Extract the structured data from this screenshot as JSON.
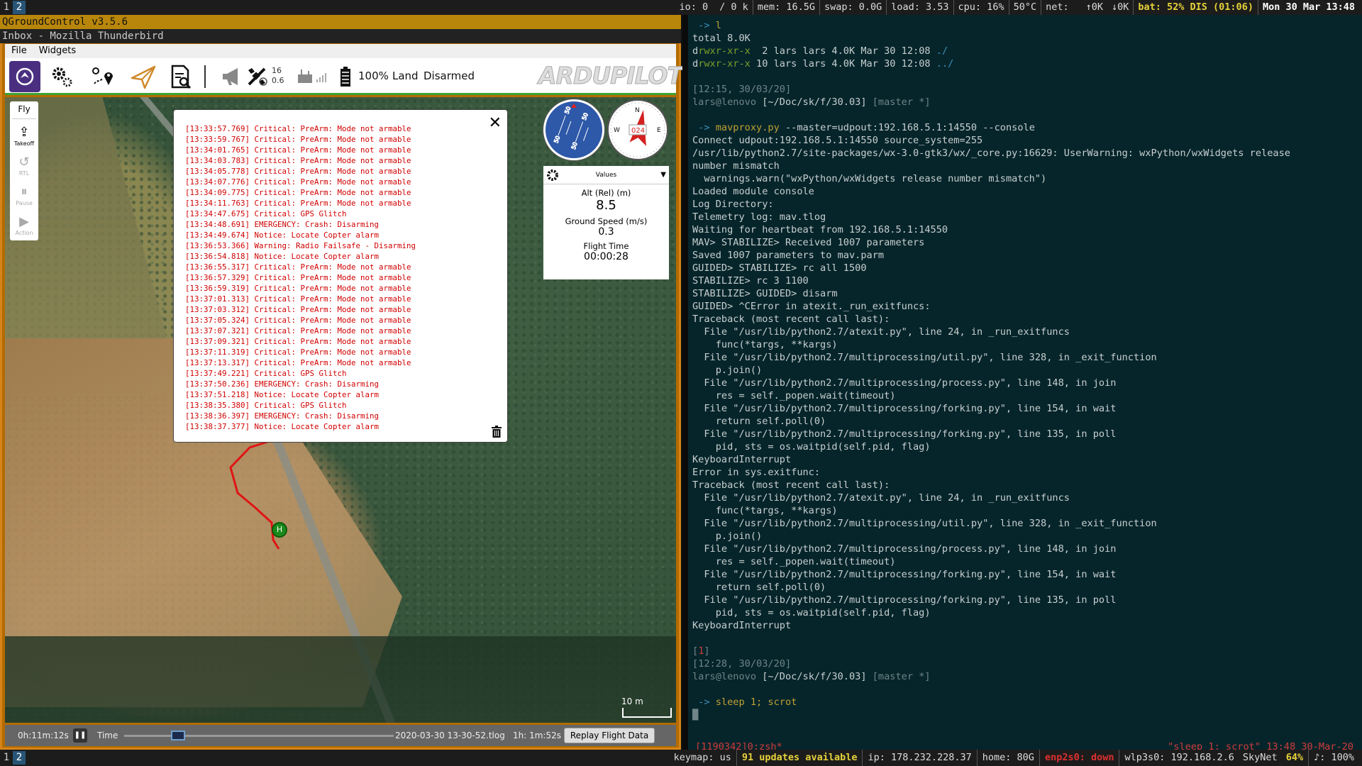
{
  "topbar": {
    "workspaces": [
      "1",
      "2"
    ],
    "io": "io: 0",
    "io_sep": "/",
    "io_k": "0 k",
    "mem": "mem: 16.5G",
    "swap": "swap: 0.0G",
    "load": "load: 3.53",
    "cpu": "cpu:  16%",
    "temp": "50°C",
    "net": "net:",
    "net_up": "↑0K",
    "net_down": "↓0K",
    "bat": "bat: 52% DIS (01:06)",
    "datetime": "Mon 30 Mar 13:48",
    "bat_color": "#e6d23a"
  },
  "left_window": {
    "title": "QGroundControl v3.5.6",
    "subtitle": "Inbox - Mozilla Thunderbird",
    "menu": [
      "File",
      "Widgets"
    ],
    "toolbar": {
      "satellites": "16",
      "hdop": "0.6",
      "battery": "100%",
      "mode": "Land",
      "arm_state": "Disarmed",
      "brand": "ARDUPILOT",
      "accent": "#3da335"
    },
    "fly_tools": [
      {
        "label": "Fly",
        "icon": "fly"
      },
      {
        "label": "Takeoff",
        "icon": "takeoff-icon"
      },
      {
        "label": "RTL",
        "icon": "rtl-icon"
      },
      {
        "label": "Pause",
        "icon": "pause-icon"
      },
      {
        "label": "Action",
        "icon": "action-icon"
      }
    ],
    "messages": [
      "[13:33:57.769] Critical: PreArm: Mode not armable",
      "[13:33:59.767] Critical: PreArm: Mode not armable",
      "[13:34:01.765] Critical: PreArm: Mode not armable",
      "[13:34:03.783] Critical: PreArm: Mode not armable",
      "[13:34:05.778] Critical: PreArm: Mode not armable",
      "[13:34:07.776] Critical: PreArm: Mode not armable",
      "[13:34:09.775] Critical: PreArm: Mode not armable",
      "[13:34:11.763] Critical: PreArm: Mode not armable",
      "[13:34:47.675] Critical: GPS Glitch",
      "[13:34:48.691] EMERGENCY: Crash: Disarming",
      "[13:34:49.674] Notice: Locate Copter alarm",
      "[13:36:53.366] Warning: Radio Failsafe - Disarming",
      "[13:36:54.818] Notice: Locate Copter alarm",
      "[13:36:55.317] Critical: PreArm: Mode not armable",
      "[13:36:57.329] Critical: PreArm: Mode not armable",
      "[13:36:59.319] Critical: PreArm: Mode not armable",
      "[13:37:01.313] Critical: PreArm: Mode not armable",
      "[13:37:03.312] Critical: PreArm: Mode not armable",
      "[13:37:05.324] Critical: PreArm: Mode not armable",
      "[13:37:07.321] Critical: PreArm: Mode not armable",
      "[13:37:09.321] Critical: PreArm: Mode not armable",
      "[13:37:11.319] Critical: PreArm: Mode not armable",
      "[13:37:13.317] Critical: PreArm: Mode not armable",
      "[13:37:49.221] Critical: GPS Glitch",
      "[13:37:50.236] EMERGENCY: Crash: Disarming",
      "[13:37:51.218] Notice: Locate Copter alarm",
      "[13:38:35.380] Critical: GPS Glitch",
      "[13:38:36.397] EMERGENCY: Crash: Disarming",
      "[13:38:37.377] Notice: Locate Copter alarm"
    ],
    "message_color": "#d00000",
    "compass_heading": "024",
    "compass_letters": [
      "N",
      "E",
      "W"
    ],
    "attitude_ticks": [
      "50",
      "50",
      "50",
      "50"
    ],
    "values": {
      "header": "Values",
      "alt_label": "Alt (Rel) (m)",
      "alt_value": "8.5",
      "speed_label": "Ground Speed (m/s)",
      "speed_value": "0.3",
      "time_label": "Flight Time",
      "time_value": "00:00:28"
    },
    "home_marker": "H",
    "track_color": "#e01515",
    "scale": "10 m",
    "replay": {
      "elapsed": "0h:11m:12s",
      "time_label": "Time",
      "position": 0.2,
      "log_name": "2020-03-30 13-30-52.tlog",
      "duration": "1h: 1m:52s",
      "button": "Replay Flight Data"
    }
  },
  "terminal": {
    "lines": [
      [
        {
          "t": " -> ",
          "c": "c-blue"
        },
        {
          "t": "l",
          "c": "c-yellow"
        }
      ],
      [
        {
          "t": "total 8.0K",
          "c": ""
        }
      ],
      [
        {
          "t": "d",
          "c": ""
        },
        {
          "t": "rwxr-xr-x",
          "c": "c-green"
        },
        {
          "t": "  2 lars lars 4.0K Mar 30 12:08 ",
          "c": ""
        },
        {
          "t": "./",
          "c": "c-blue"
        }
      ],
      [
        {
          "t": "d",
          "c": ""
        },
        {
          "t": "rwxr-xr-x",
          "c": "c-green"
        },
        {
          "t": " 10 lars lars 4.0K Mar 30 12:08 ",
          "c": ""
        },
        {
          "t": "../",
          "c": "c-blue"
        }
      ],
      [
        {
          "t": "",
          "c": ""
        }
      ],
      [
        {
          "t": "[12:15, 30/03/20]",
          "c": "c-gray"
        }
      ],
      [
        {
          "t": "lars@lenovo ",
          "c": "c-gray"
        },
        {
          "t": "[~/Doc/sk/f/30.03]",
          "c": ""
        },
        {
          "t": " [master *]",
          "c": "c-gray"
        }
      ],
      [
        {
          "t": "",
          "c": ""
        }
      ],
      [
        {
          "t": " -> ",
          "c": "c-blue"
        },
        {
          "t": "mavproxy.py",
          "c": "c-yellow"
        },
        {
          "t": " --master=udpout:192.168.5.1:14550 --console",
          "c": ""
        }
      ],
      [
        {
          "t": "Connect udpout:192.168.5.1:14550 source_system=255",
          "c": ""
        }
      ],
      [
        {
          "t": "/usr/lib/python2.7/site-packages/wx-3.0-gtk3/wx/_core.py:16629: UserWarning: wxPython/wxWidgets release",
          "c": ""
        }
      ],
      [
        {
          "t": "number mismatch",
          "c": ""
        }
      ],
      [
        {
          "t": "  warnings.warn(\"wxPython/wxWidgets release number mismatch\")",
          "c": ""
        }
      ],
      [
        {
          "t": "Loaded module console",
          "c": ""
        }
      ],
      [
        {
          "t": "Log Directory:",
          "c": ""
        }
      ],
      [
        {
          "t": "Telemetry log: mav.tlog",
          "c": ""
        }
      ],
      [
        {
          "t": "Waiting for heartbeat from 192.168.5.1:14550",
          "c": ""
        }
      ],
      [
        {
          "t": "MAV> STABILIZE> Received 1007 parameters",
          "c": ""
        }
      ],
      [
        {
          "t": "Saved 1007 parameters to mav.parm",
          "c": ""
        }
      ],
      [
        {
          "t": "GUIDED> STABILIZE> rc all 1500",
          "c": ""
        }
      ],
      [
        {
          "t": "STABILIZE> rc 3 1100",
          "c": ""
        }
      ],
      [
        {
          "t": "STABILIZE> GUIDED> disarm",
          "c": ""
        }
      ],
      [
        {
          "t": "GUIDED> ^CError in atexit._run_exitfuncs:",
          "c": ""
        }
      ],
      [
        {
          "t": "Traceback (most recent call last):",
          "c": ""
        }
      ],
      [
        {
          "t": "  File \"/usr/lib/python2.7/atexit.py\", line 24, in _run_exitfuncs",
          "c": ""
        }
      ],
      [
        {
          "t": "    func(*targs, **kargs)",
          "c": ""
        }
      ],
      [
        {
          "t": "  File \"/usr/lib/python2.7/multiprocessing/util.py\", line 328, in _exit_function",
          "c": ""
        }
      ],
      [
        {
          "t": "    p.join()",
          "c": ""
        }
      ],
      [
        {
          "t": "  File \"/usr/lib/python2.7/multiprocessing/process.py\", line 148, in join",
          "c": ""
        }
      ],
      [
        {
          "t": "    res = self._popen.wait(timeout)",
          "c": ""
        }
      ],
      [
        {
          "t": "  File \"/usr/lib/python2.7/multiprocessing/forking.py\", line 154, in wait",
          "c": ""
        }
      ],
      [
        {
          "t": "    return self.poll(0)",
          "c": ""
        }
      ],
      [
        {
          "t": "  File \"/usr/lib/python2.7/multiprocessing/forking.py\", line 135, in poll",
          "c": ""
        }
      ],
      [
        {
          "t": "    pid, sts = os.waitpid(self.pid, flag)",
          "c": ""
        }
      ],
      [
        {
          "t": "KeyboardInterrupt",
          "c": ""
        }
      ],
      [
        {
          "t": "Error in sys.exitfunc:",
          "c": ""
        }
      ],
      [
        {
          "t": "Traceback (most recent call last):",
          "c": ""
        }
      ],
      [
        {
          "t": "  File \"/usr/lib/python2.7/atexit.py\", line 24, in _run_exitfuncs",
          "c": ""
        }
      ],
      [
        {
          "t": "    func(*targs, **kargs)",
          "c": ""
        }
      ],
      [
        {
          "t": "  File \"/usr/lib/python2.7/multiprocessing/util.py\", line 328, in _exit_function",
          "c": ""
        }
      ],
      [
        {
          "t": "    p.join()",
          "c": ""
        }
      ],
      [
        {
          "t": "  File \"/usr/lib/python2.7/multiprocessing/process.py\", line 148, in join",
          "c": ""
        }
      ],
      [
        {
          "t": "    res = self._popen.wait(timeout)",
          "c": ""
        }
      ],
      [
        {
          "t": "  File \"/usr/lib/python2.7/multiprocessing/forking.py\", line 154, in wait",
          "c": ""
        }
      ],
      [
        {
          "t": "    return self.poll(0)",
          "c": ""
        }
      ],
      [
        {
          "t": "  File \"/usr/lib/python2.7/multiprocessing/forking.py\", line 135, in poll",
          "c": ""
        }
      ],
      [
        {
          "t": "    pid, sts = os.waitpid(self.pid, flag)",
          "c": ""
        }
      ],
      [
        {
          "t": "KeyboardInterrupt",
          "c": ""
        }
      ],
      [
        {
          "t": "",
          "c": ""
        }
      ],
      [
        {
          "t": "[",
          "c": "c-gray"
        },
        {
          "t": "1",
          "c": "c-red"
        },
        {
          "t": "]",
          "c": "c-gray"
        }
      ],
      [
        {
          "t": "[12:28, 30/03/20]",
          "c": "c-gray"
        }
      ],
      [
        {
          "t": "lars@lenovo ",
          "c": "c-gray"
        },
        {
          "t": "[~/Doc/sk/f/30.03]",
          "c": ""
        },
        {
          "t": " [master *]",
          "c": "c-gray"
        }
      ],
      [
        {
          "t": "",
          "c": ""
        }
      ],
      [
        {
          "t": " -> ",
          "c": "c-blue"
        },
        {
          "t": "sleep 1; scrot",
          "c": "c-yellow"
        }
      ],
      [
        {
          "t": "█",
          "c": "c-gray"
        }
      ]
    ],
    "tmux_left": "[1190342]0:zsh*",
    "tmux_right": "\"sleep 1; scrot\" 13:48 30-Mar-20",
    "tmux_color": "#cf3c3c"
  },
  "bottombar": {
    "workspaces": [
      "1",
      "2"
    ],
    "keymap": "keymap: us",
    "updates": "91 updates available",
    "ip": "ip: 178.232.228.37",
    "home": "home: 80G",
    "eth": "enp2s0: down",
    "wifi": "wlp3s0: 192.168.2.6",
    "ssid": "SkyNet",
    "wifi_q": "64%",
    "vol": "♪: 100%",
    "updates_color": "#e6d23a",
    "eth_color": "#e03030"
  }
}
